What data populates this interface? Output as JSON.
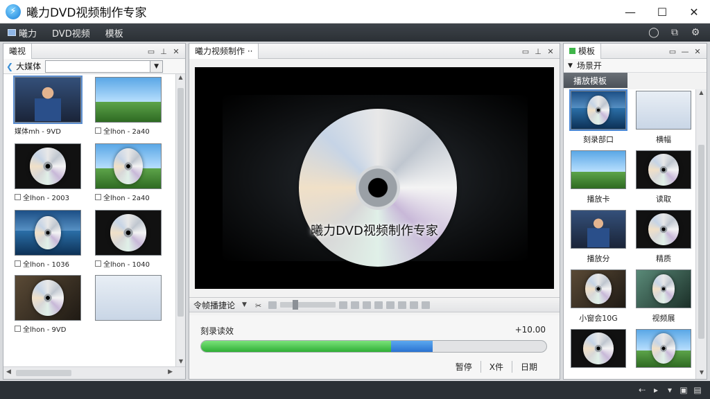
{
  "app": {
    "title": "曦力DVD视频制作专家",
    "window_controls": {
      "minimize": "—",
      "maximize": "☐",
      "close": "✕"
    }
  },
  "menu": {
    "items": [
      "曦力",
      "DVD视频",
      "模板"
    ],
    "right_icons": [
      "chat-icon",
      "share-icon",
      "settings-icon"
    ]
  },
  "left_panel": {
    "tab": "曦视",
    "filter_label": "大媒体",
    "filter_value": "",
    "thumbnails": [
      {
        "caption": "媒体mh - 9VD",
        "scene": "person",
        "selected": true,
        "checkbox": false
      },
      {
        "caption": "全lhon - 2a40",
        "scene": "field",
        "selected": false,
        "checkbox": true
      },
      {
        "caption": "全lhon - 2003",
        "scene": "disc",
        "selected": false,
        "checkbox": true
      },
      {
        "caption": "全lhon - 2a40",
        "scene": "disc-field",
        "selected": false,
        "checkbox": true
      },
      {
        "caption": "全lhon - 1036",
        "scene": "disc-ocean",
        "selected": false,
        "checkbox": true
      },
      {
        "caption": "全lhon - 1040",
        "scene": "disc",
        "selected": false,
        "checkbox": true
      },
      {
        "caption": "全lhon - 9VD",
        "scene": "disc-room",
        "selected": false,
        "checkbox": true
      },
      {
        "caption": "",
        "scene": "white",
        "selected": false,
        "checkbox": false
      }
    ]
  },
  "center_panel": {
    "tab": "曦力视频制作",
    "preview_text": "曦力DVD视频制作专家",
    "transport_label": "令帧播捷论",
    "progress": {
      "label": "刻录读效",
      "value_text": "+10.00",
      "green_fraction": 0.55,
      "blue_fraction": 0.12
    },
    "actions": [
      "暂停",
      "X件",
      "日期"
    ]
  },
  "right_panel": {
    "tab": "模板",
    "tree_node": "场景开",
    "category": "播放模板",
    "templates": [
      {
        "caption": "刻录部口",
        "scene": "disc-ocean",
        "selected": true
      },
      {
        "caption": "横幅",
        "scene": "white",
        "selected": false
      },
      {
        "caption": "播放卡",
        "scene": "field",
        "selected": false
      },
      {
        "caption": "读取",
        "scene": "disc",
        "selected": false
      },
      {
        "caption": "播放分",
        "scene": "person",
        "selected": false
      },
      {
        "caption": "精质",
        "scene": "disc",
        "selected": false
      },
      {
        "caption": "小窗会10G",
        "scene": "disc-room",
        "selected": false
      },
      {
        "caption": "视频展",
        "scene": "disc-green",
        "selected": false
      },
      {
        "caption": "",
        "scene": "disc",
        "selected": false
      },
      {
        "caption": "",
        "scene": "disc-field",
        "selected": false
      }
    ]
  },
  "status_icons": [
    "back-icon",
    "play-icon",
    "wifi-icon",
    "folder-icon",
    "window-icon"
  ],
  "colors": {
    "progress_green": "#2fae36",
    "progress_blue": "#2a72d0",
    "selection": "#4a88d6",
    "menubar": "#2b3035"
  }
}
